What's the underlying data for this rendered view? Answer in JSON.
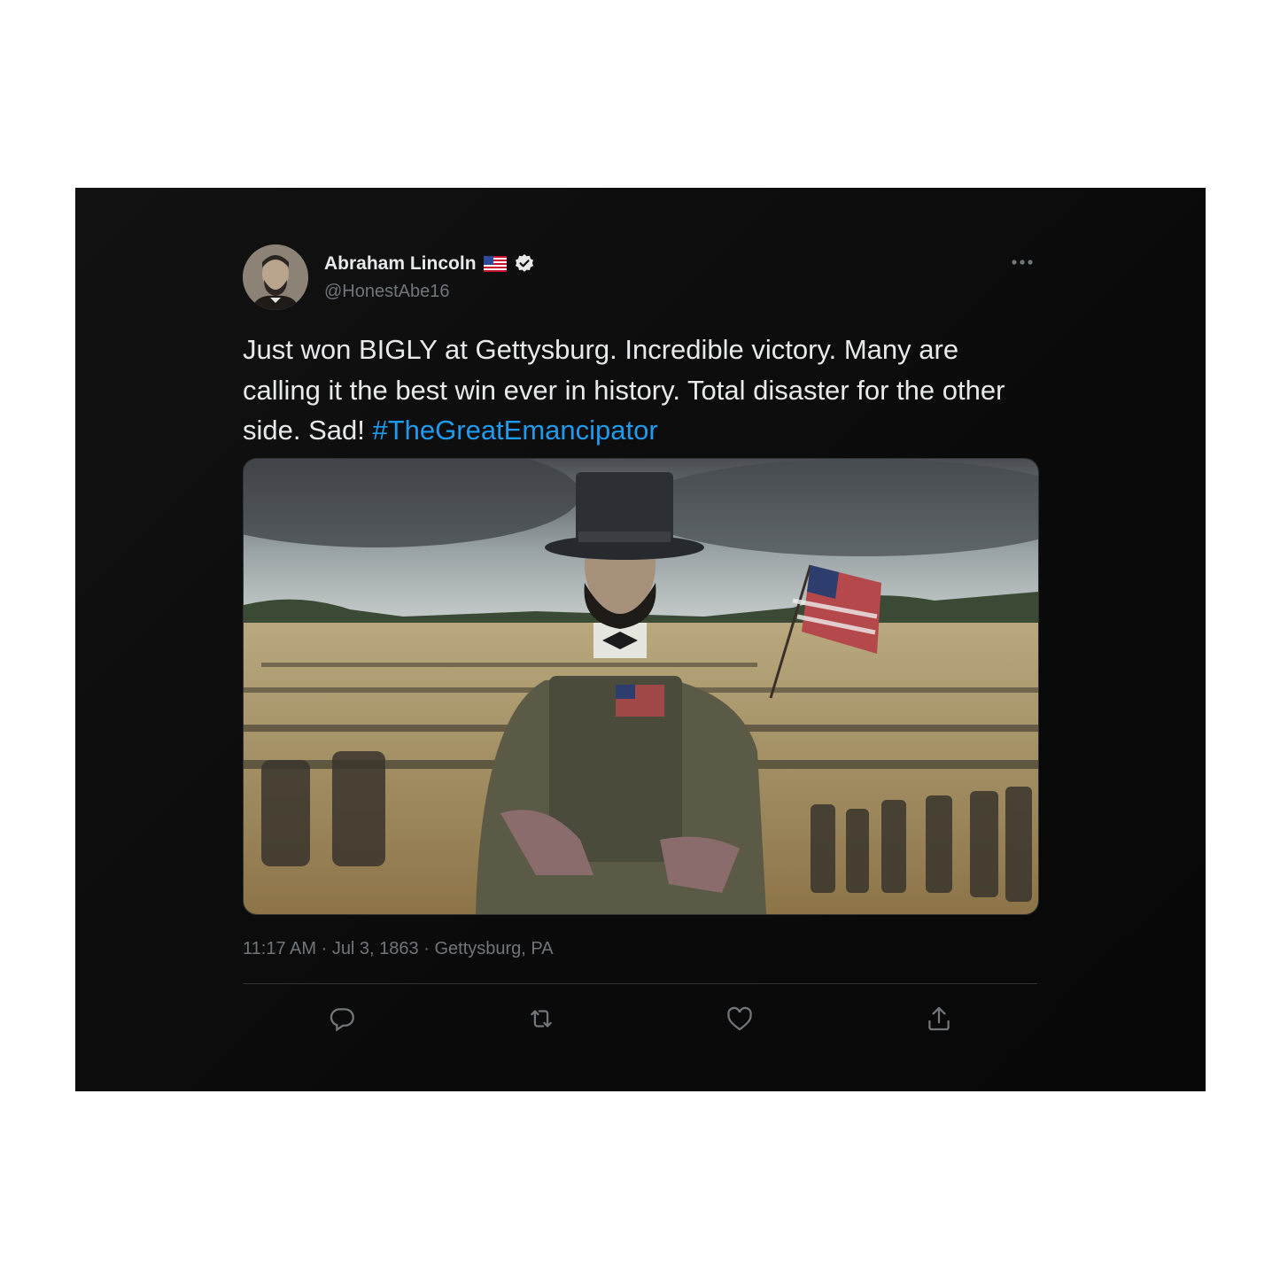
{
  "tweet": {
    "author": {
      "name": "Abraham Lincoln",
      "flag_icon": "us-flag-icon",
      "verified_icon": "verified-badge-icon",
      "handle": "@HonestAbe16"
    },
    "more_icon": "more-options-icon",
    "text": "Just won BIGLY at Gettysburg. Incredible victory. Many are calling it the best win ever in history. Total disaster for the other side. Sad! ",
    "hashtag": "#TheGreatEmancipator",
    "media_description_icon": "tweet-photo",
    "time": "11:17 AM",
    "date": "Jul 3, 1863",
    "location": "Gettysburg, PA",
    "separator": " · ",
    "colors": {
      "background": "#0f0f0f",
      "text": "#e7e9ea",
      "secondary": "#71767b",
      "link": "#1d9bf0",
      "divider": "#2f3336"
    }
  },
  "actions": [
    {
      "icon": "reply-icon"
    },
    {
      "icon": "retweet-icon"
    },
    {
      "icon": "like-icon"
    },
    {
      "icon": "share-icon"
    }
  ]
}
